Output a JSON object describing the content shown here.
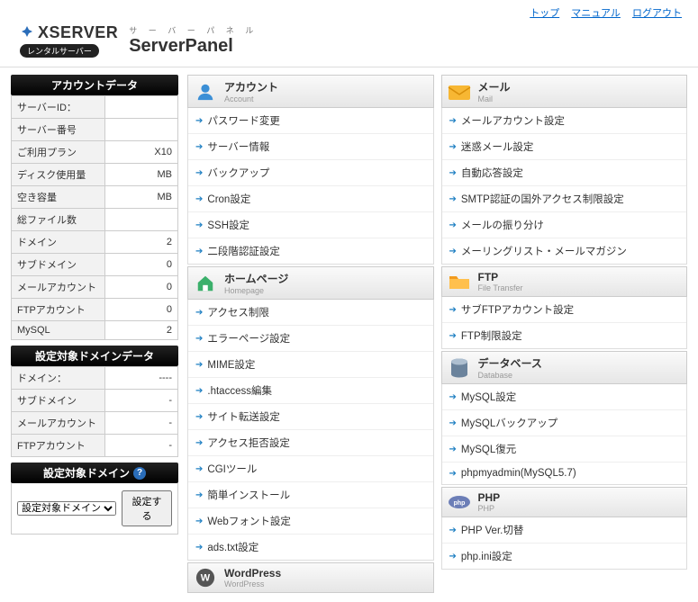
{
  "topLinks": [
    "トップ",
    "マニュアル",
    "ログアウト"
  ],
  "brand": {
    "name": "XSERVER",
    "badge": "レンタルサーバー",
    "panelSub": "サ ー バ ー パ ネ ル",
    "panelMain": "ServerPanel"
  },
  "sidebar": {
    "accountHeader": "アカウントデータ",
    "accountRows": [
      {
        "label": "サーバーID：",
        "value": ""
      },
      {
        "label": "サーバー番号",
        "value": ""
      },
      {
        "label": "ご利用プラン",
        "value": "X10"
      },
      {
        "label": "ディスク使用量",
        "value": "MB"
      },
      {
        "label": "空き容量",
        "value": "MB"
      },
      {
        "label": "総ファイル数",
        "value": ""
      },
      {
        "label": "ドメイン",
        "value": "2"
      },
      {
        "label": "サブドメイン",
        "value": "0"
      },
      {
        "label": "メールアカウント",
        "value": "0"
      },
      {
        "label": "FTPアカウント",
        "value": "0"
      },
      {
        "label": "MySQL",
        "value": "2"
      }
    ],
    "targetDomainHeader": "設定対象ドメインデータ",
    "targetDomainRows": [
      {
        "label": "ドメイン：",
        "value": "----"
      },
      {
        "label": "サブドメイン",
        "value": "-"
      },
      {
        "label": "メールアカウント",
        "value": "-"
      },
      {
        "label": "FTPアカウント",
        "value": "-"
      }
    ],
    "selectHeader": "設定対象ドメイン",
    "selectPlaceholder": "設定対象ドメイン未",
    "selectButton": "設定する"
  },
  "categories": {
    "left": [
      {
        "id": "account",
        "jp": "アカウント",
        "en": "Account",
        "icon": "person",
        "items": [
          "パスワード変更",
          "サーバー情報",
          "バックアップ",
          "Cron設定",
          "SSH設定",
          "二段階認証設定"
        ]
      },
      {
        "id": "homepage",
        "jp": "ホームページ",
        "en": "Homepage",
        "icon": "home",
        "items": [
          "アクセス制限",
          "エラーページ設定",
          "MIME設定",
          ".htaccess編集",
          "サイト転送設定",
          "アクセス拒否設定",
          "CGIツール",
          "簡単インストール",
          "Webフォント設定",
          "ads.txt設定"
        ]
      },
      {
        "id": "wordpress",
        "jp": "WordPress",
        "en": "WordPress",
        "icon": "wp",
        "items": []
      }
    ],
    "right": [
      {
        "id": "mail",
        "jp": "メール",
        "en": "Mail",
        "icon": "mail",
        "items": [
          "メールアカウント設定",
          "迷惑メール設定",
          "自動応答設定",
          "SMTP認証の国外アクセス制限設定",
          "メールの振り分け",
          "メーリングリスト・メールマガジン"
        ]
      },
      {
        "id": "ftp",
        "jp": "FTP",
        "en": "File Transfer",
        "icon": "folder",
        "items": [
          "サブFTPアカウント設定",
          "FTP制限設定"
        ]
      },
      {
        "id": "database",
        "jp": "データベース",
        "en": "Database",
        "icon": "db",
        "items": [
          "MySQL設定",
          "MySQLバックアップ",
          "MySQL復元",
          "phpmyadmin(MySQL5.7)"
        ]
      },
      {
        "id": "php",
        "jp": "PHP",
        "en": "PHP",
        "icon": "php",
        "items": [
          "PHP Ver.切替",
          "php.ini設定"
        ]
      }
    ]
  }
}
